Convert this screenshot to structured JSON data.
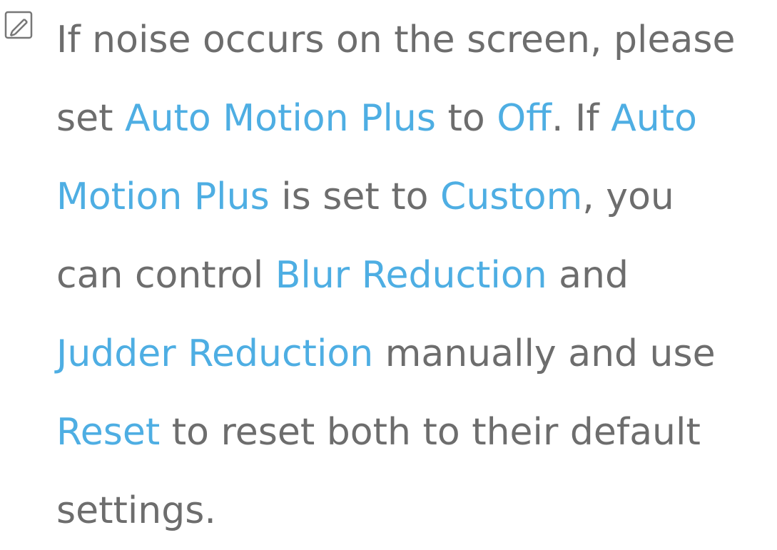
{
  "note": {
    "icon": "note-pencil-icon",
    "colors": {
      "text": "#6d6d6d",
      "highlight": "#4eaee3",
      "icon": "#777777"
    },
    "lines": [
      [
        {
          "text": "If noise occurs on the screen, please",
          "highlight": false
        }
      ],
      [
        {
          "text": "set ",
          "highlight": false
        },
        {
          "text": "Auto Motion Plus",
          "highlight": true
        },
        {
          "text": " to ",
          "highlight": false
        },
        {
          "text": "Off",
          "highlight": true
        },
        {
          "text": ". If ",
          "highlight": false
        },
        {
          "text": "Auto",
          "highlight": true
        }
      ],
      [
        {
          "text": "Motion Plus",
          "highlight": true
        },
        {
          "text": " is set to ",
          "highlight": false
        },
        {
          "text": "Custom",
          "highlight": true
        },
        {
          "text": ", you",
          "highlight": false
        }
      ],
      [
        {
          "text": "can control ",
          "highlight": false
        },
        {
          "text": "Blur Reduction",
          "highlight": true
        },
        {
          "text": " and",
          "highlight": false
        }
      ],
      [
        {
          "text": "Judder Reduction",
          "highlight": true
        },
        {
          "text": " manually and use",
          "highlight": false
        }
      ],
      [
        {
          "text": "Reset",
          "highlight": true
        },
        {
          "text": " to reset both to their default",
          "highlight": false
        }
      ],
      [
        {
          "text": "settings.",
          "highlight": false
        }
      ]
    ]
  }
}
